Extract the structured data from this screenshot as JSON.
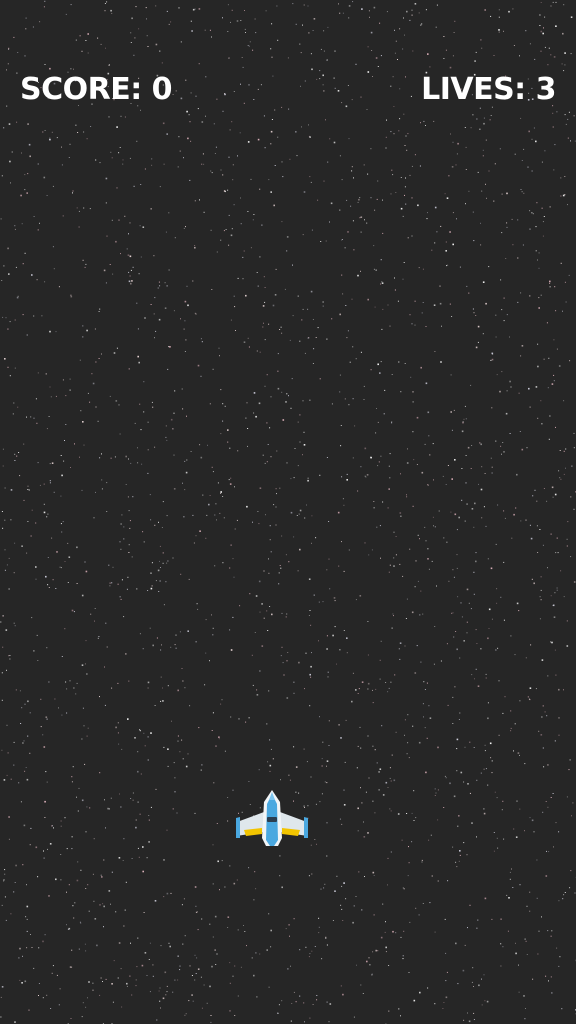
{
  "hud": {
    "score_label": "SCORE:",
    "score_value": "0",
    "lives_label": "LIVES:",
    "lives_value": "3"
  },
  "colors": {
    "background": "#262626",
    "hud_text": "#ffffff",
    "ship_body": "#e8eef2",
    "ship_accent": "#4aa8e0",
    "ship_engine": "#f2c400"
  },
  "player": {
    "sprite": "spaceship-icon"
  }
}
